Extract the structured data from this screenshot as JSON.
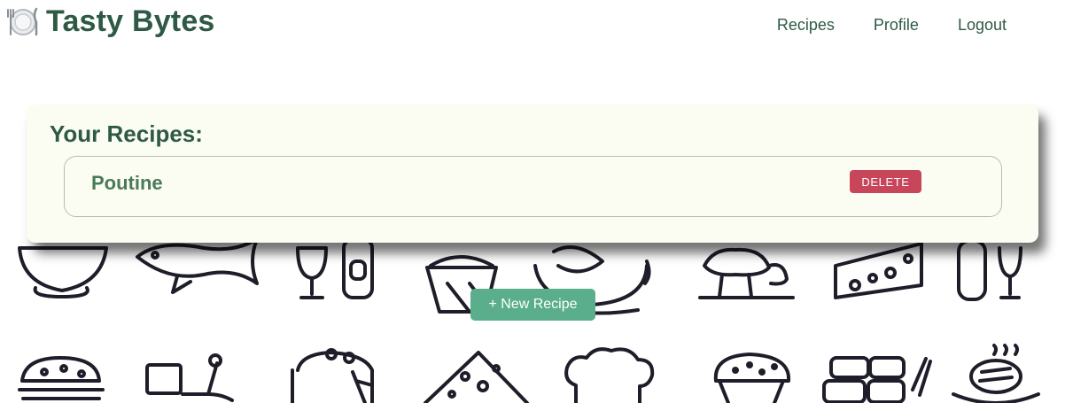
{
  "app": {
    "brand_icon": "plate-cutlery-icon",
    "title": "Tasty Bytes"
  },
  "nav": {
    "items": [
      {
        "label": "Recipes"
      },
      {
        "label": "Profile"
      },
      {
        "label": "Logout"
      }
    ]
  },
  "recipes_panel": {
    "heading": "Your Recipes:",
    "items": [
      {
        "name": "Poutine",
        "delete_label": "DELETE"
      }
    ]
  },
  "actions": {
    "new_recipe_label": "+ New Recipe"
  },
  "colors": {
    "brand": "#2e5a45",
    "card_bg": "#fbfdf2",
    "delete": "#c8465a",
    "primary": "#5aae8c"
  },
  "background_icons": [
    "bowl-icon",
    "fish-icon",
    "glass-bottle-icon",
    "cupcake-icon",
    "cup-saucer-icon",
    "mushroom-icon",
    "cheese-icon",
    "bottle-glass-icon",
    "burger-icon",
    "delivery-scooter-icon",
    "layer-cake-icon",
    "pizza-slice-icon",
    "chef-hat-icon",
    "muffin-icon",
    "sushi-icon",
    "steak-plate-icon"
  ]
}
